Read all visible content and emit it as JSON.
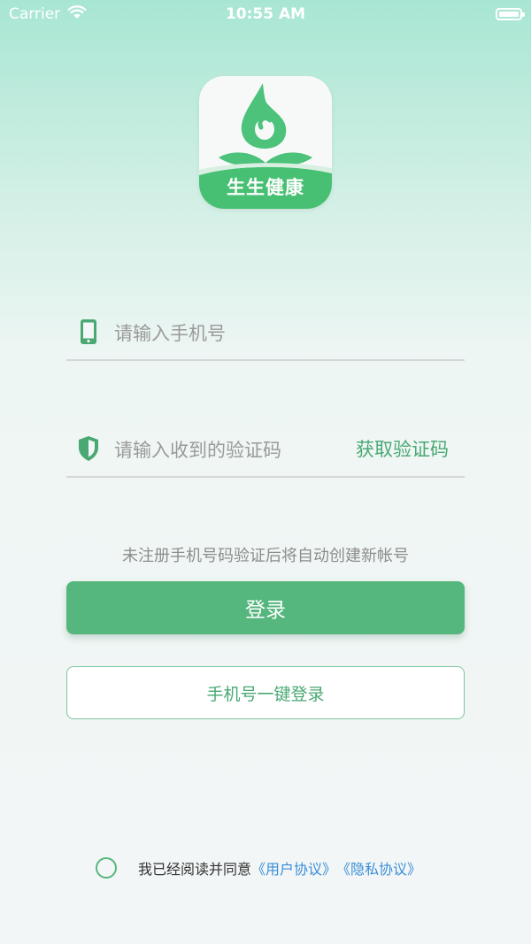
{
  "status_bar": {
    "carrier": "Carrier",
    "time": "10:55 AM",
    "battery_level": 1.0,
    "color": "#ffffff"
  },
  "logo": {
    "text": "生生健康",
    "brand_color": "#48c073"
  },
  "phone_field": {
    "placeholder": "请输入手机号",
    "value": "",
    "icon": "phone-icon"
  },
  "code_field": {
    "placeholder": "请输入收到的验证码",
    "value": "",
    "icon": "shield-icon",
    "get_code_label": "获取验证码"
  },
  "hint": "未注册手机号码验证后将自动创建新帐号",
  "login_button": {
    "label": "登录",
    "color": "#55b77d"
  },
  "quick_login_button": {
    "label": "手机号一键登录"
  },
  "agreement": {
    "prefix": "我已经阅读并同意",
    "user_agreement": "《用户协议》",
    "privacy_policy": "《隐私协议》",
    "link_color": "#3a8ed8",
    "checked": false
  }
}
